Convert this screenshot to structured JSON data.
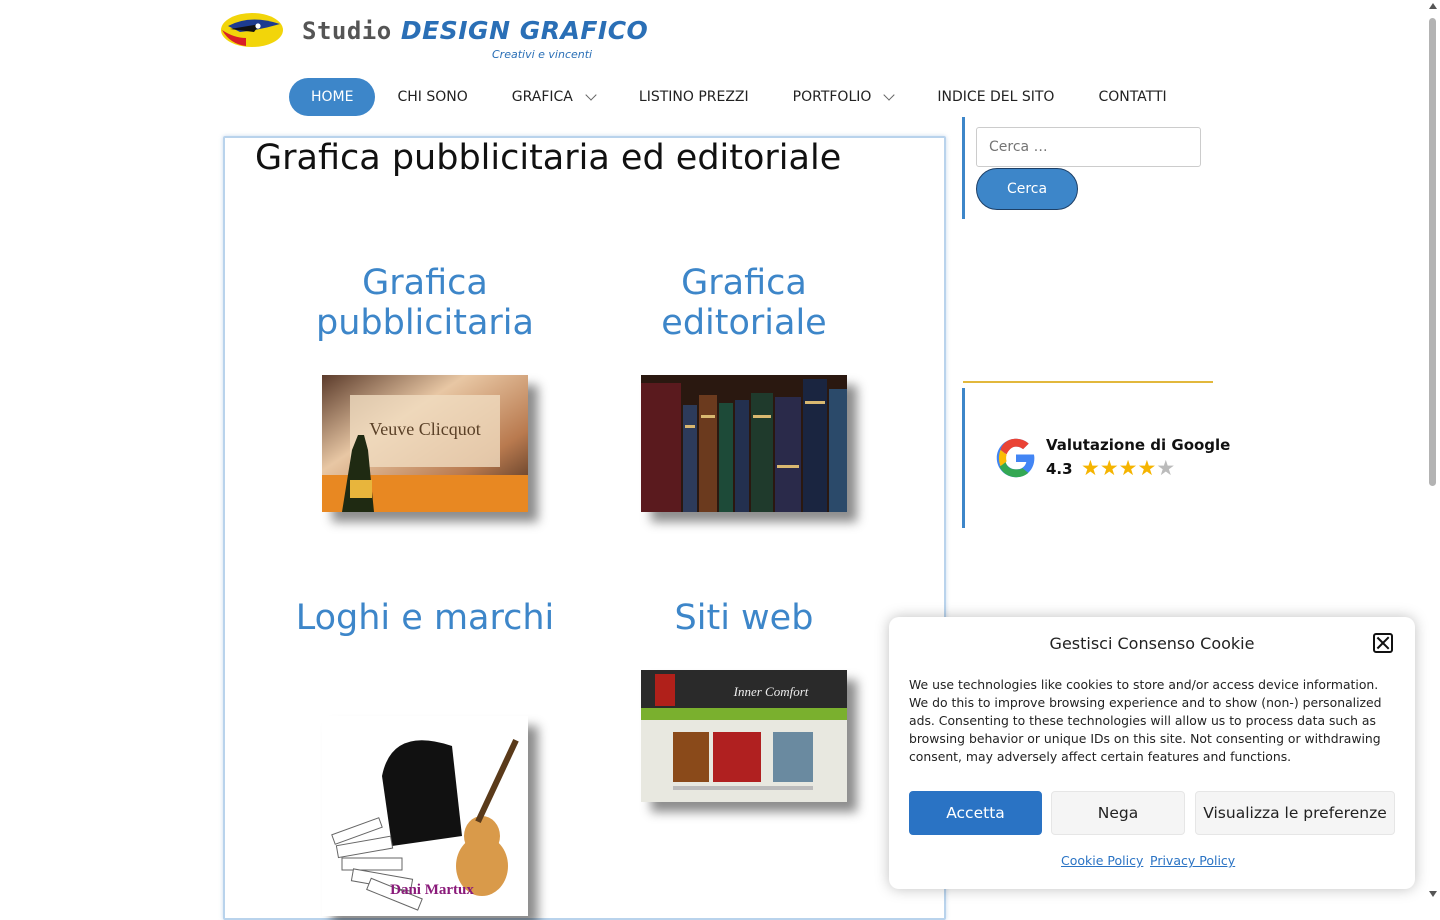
{
  "header": {
    "brand_studio": "Studio",
    "brand_name": "DESIGN GRAFICO",
    "tagline": "Creativi e vincenti"
  },
  "nav": {
    "items": [
      {
        "label": "HOME",
        "active": true
      },
      {
        "label": "CHI SONO"
      },
      {
        "label": "GRAFICA",
        "dropdown": true
      },
      {
        "label": "LISTINO PREZZI"
      },
      {
        "label": "PORTFOLIO",
        "dropdown": true
      },
      {
        "label": "INDICE DEL SITO"
      },
      {
        "label": "CONTATTI"
      }
    ]
  },
  "main": {
    "title": "Grafica pubblicitaria ed editoriale",
    "cards": [
      {
        "title": "Grafica pubblicitaria",
        "image": "champagne-photo",
        "image_text": "Veuve Clicquot"
      },
      {
        "title": "Grafica editoriale",
        "image": "books-photo"
      },
      {
        "title": "Loghi e marchi",
        "image": "piano-guitar-logo",
        "image_text": "Dani Martux"
      },
      {
        "title": "Siti web",
        "image": "website-screenshot",
        "image_text": "Inner Comfort"
      }
    ]
  },
  "sidebar": {
    "search_placeholder": "Cerca …",
    "search_button": "Cerca",
    "google": {
      "title": "Valutazione di Google",
      "score": "4.3",
      "stars": 4.3
    }
  },
  "cookie": {
    "title": "Gestisci Consenso Cookie",
    "text": "We use technologies like cookies to store and/or access device information. We do this to improve browsing experience and to show (non-) personalized ads. Consenting to these technologies will allow us to process data such as browsing behavior or unique IDs on this site. Not consenting or withdrawing consent, may adversely affect certain features and functions.",
    "accept": "Accetta",
    "deny": "Nega",
    "preferences": "Visualizza le preferenze",
    "cookie_policy": "Cookie Policy",
    "privacy_policy": "Privacy Policy"
  },
  "colors": {
    "accent": "#3d86c9",
    "gold": "#e2b83c",
    "cookie_accept": "#2a73c4",
    "star": "#f5b400"
  }
}
